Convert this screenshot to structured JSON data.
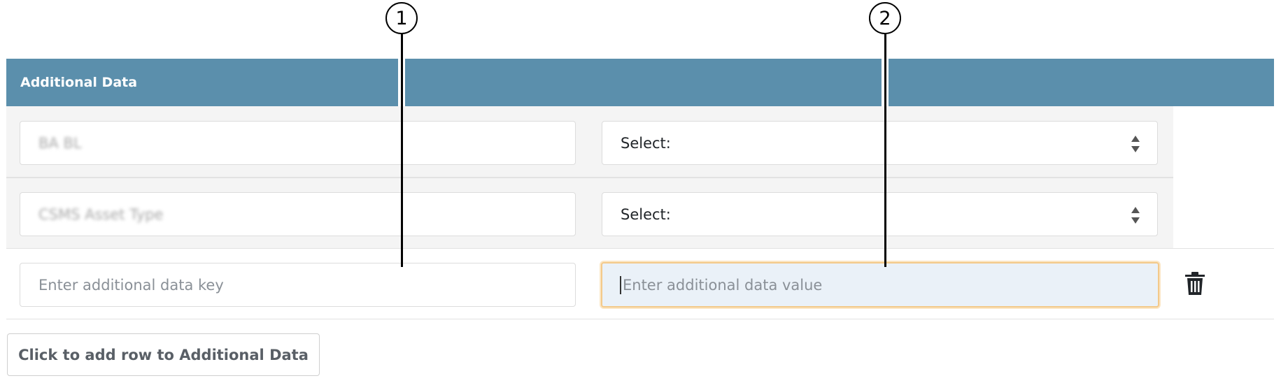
{
  "panel": {
    "title": "Additional Data"
  },
  "rows": [
    {
      "key_value": "BA BL",
      "value_select": "Select:"
    },
    {
      "key_value": "CSMS Asset Type",
      "value_select": "Select:"
    }
  ],
  "new_row": {
    "key_placeholder": "Enter additional data key",
    "value_placeholder": "Enter additional data value"
  },
  "add_button_label": "Click to add row to Additional Data",
  "callouts": [
    "1",
    "2"
  ],
  "icons": {
    "select_arrows": "up-down-icon",
    "delete": "trash-icon"
  },
  "colors": {
    "header": "#5b8fac",
    "focus_border": "#f3c98a"
  }
}
